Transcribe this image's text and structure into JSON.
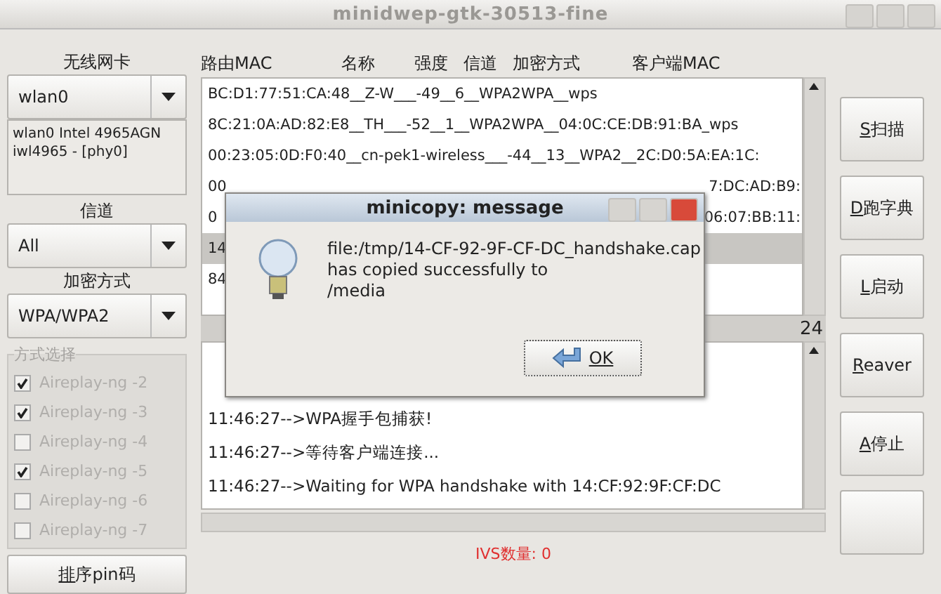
{
  "window": {
    "title": "minidwep-gtk-30513-fine"
  },
  "left": {
    "card_label": "无线网卡",
    "card": "wlan0",
    "card_info": "wlan0 Intel 4965AGN\niwl4965 - [phy0]",
    "channel_label": "信道",
    "channel": "All",
    "enc_label": "加密方式",
    "enc": "WPA/WPA2",
    "methods_label": "方式选择",
    "methods": [
      {
        "label": "Aireplay-ng -2",
        "checked": true
      },
      {
        "label": "Aireplay-ng -3",
        "checked": true
      },
      {
        "label": "Aireplay-ng -4",
        "checked": false
      },
      {
        "label": "Aireplay-ng -5",
        "checked": true
      },
      {
        "label": "Aireplay-ng -6",
        "checked": false
      },
      {
        "label": "Aireplay-ng -7",
        "checked": false
      }
    ],
    "pin_button": "排序pin码"
  },
  "columns": [
    "路由MAC",
    "名称",
    "强度",
    "信道",
    "加密方式",
    "客户端MAC"
  ],
  "rows": [
    {
      "text": "BC:D1:77:51:CA:48__Z-W___-49__6__WPA2WPA__wps",
      "selected": false
    },
    {
      "text": "8C:21:0A:AD:82:E8__TH___-52__1__WPA2WPA__04:0C:CE:DB:91:BA_wps",
      "selected": false
    },
    {
      "text": "00:23:05:0D:F0:40__cn-pek1-wireless___-44__13__WPA2__2C:D0:5A:EA:1C:",
      "selected": false
    },
    {
      "text": "00",
      "right": "7:DC:AD:B9:",
      "selected": false
    },
    {
      "text": "0",
      "right": "06:07:BB:11:",
      "selected": false
    },
    {
      "text": "14",
      "selected": true
    },
    {
      "text": "84",
      "selected": false
    }
  ],
  "count": "24",
  "log": [
    "11:46:27-->WPA握手包捕获!",
    "11:46:27-->等待客户端连接...",
    "11:46:27-->Waiting for WPA handshake with 14:CF:92:9F:CF:DC"
  ],
  "buttons": [
    "S扫描",
    "D跑字典",
    "L启动",
    "Reaver",
    "A停止"
  ],
  "status": "IVS数量: 0",
  "dialog": {
    "title": "minicopy: message",
    "message": "file:/tmp/14-CF-92-9F-CF-DC_handshake.cap\nhas copied successfully to\n/media",
    "ok": "OK"
  }
}
